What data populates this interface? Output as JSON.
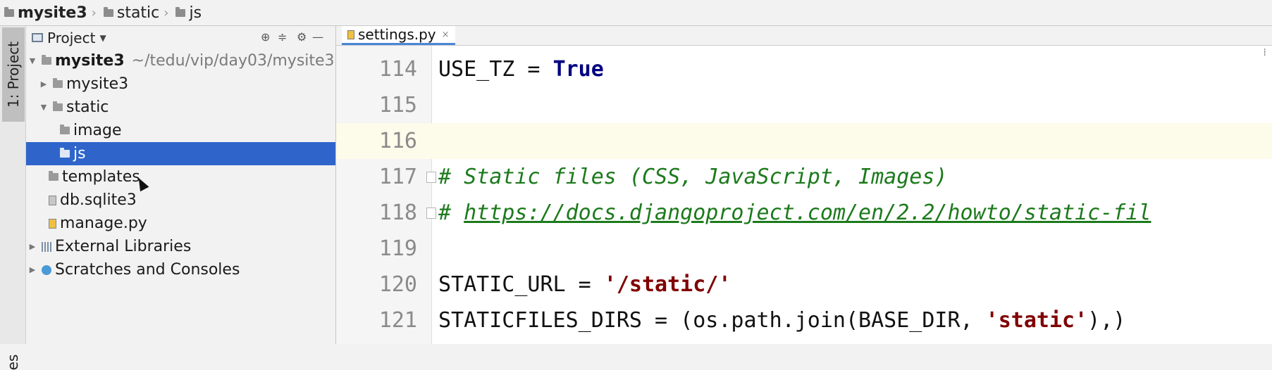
{
  "breadcrumb": {
    "root": "mysite3",
    "items": [
      "static",
      "js"
    ]
  },
  "tool_windows": {
    "project_tab": "1: Project",
    "bottom_tab": "es"
  },
  "project_panel": {
    "title": "Project",
    "dropdown_icon": "chevron-down-icon",
    "tree": {
      "root": {
        "label": "mysite3",
        "path": "~/tedu/vip/day03/mysite3"
      },
      "folder_mysite3": "mysite3",
      "folder_static": "static",
      "folder_image": "image",
      "folder_js": "js",
      "folder_templates": "templates",
      "file_db": "db.sqlite3",
      "file_manage": "manage.py",
      "external_libraries": "External Libraries",
      "scratches": "Scratches and Consoles"
    }
  },
  "editor": {
    "tab_label": "settings.py",
    "tab_close": "×",
    "caret_line": "116",
    "lines": [
      {
        "num": "114",
        "p1": "USE_TZ = ",
        "kw": "True"
      },
      {
        "num": "115"
      },
      {
        "num": "116"
      },
      {
        "num": "117",
        "comment": "# Static files (CSS, JavaScript, Images)"
      },
      {
        "num": "118",
        "hash": "# ",
        "link": "https://docs.djangoproject.com/en/2.2/howto/static-fil"
      },
      {
        "num": "119"
      },
      {
        "num": "120",
        "p1": "STATIC_URL = ",
        "str": "'/static/'"
      },
      {
        "num": "121",
        "p1": "STATICFILES_DIRS = (os.path.join(BASE_DIR, ",
        "str": "'static'",
        "p2": "),)"
      }
    ]
  },
  "colors": {
    "selection": "#2f65ca",
    "keyword": "#000080",
    "string": "#800000",
    "comment": "#1c7a1c",
    "caret_row": "#fdfbea"
  }
}
